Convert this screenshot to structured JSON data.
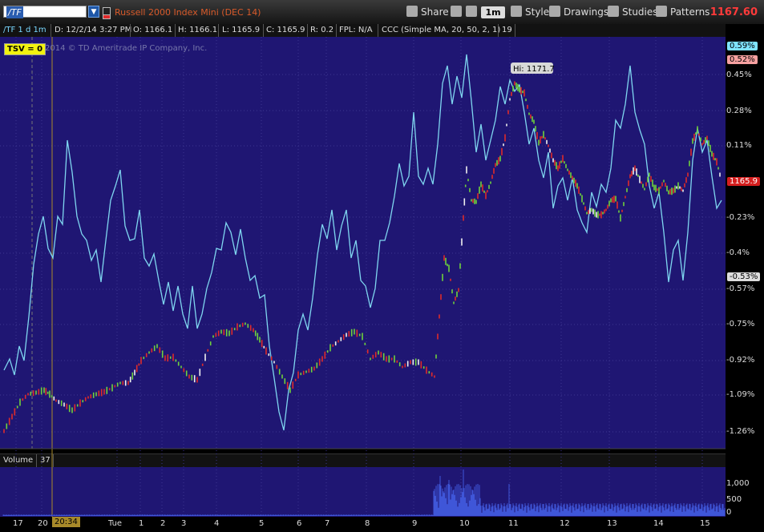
{
  "toolbar": {
    "symbol": "/TF",
    "title": "Russell 2000 Index Mini (DEC 14)",
    "share": "Share",
    "timeframe": "1m",
    "style": "Style",
    "drawings": "Drawings",
    "studies": "Studies",
    "patterns": "Patterns",
    "last_price": "1167.60"
  },
  "infobar": {
    "symbol_period": "/TF 1 d 1m",
    "date": "D: 12/2/14 3:27 PM",
    "open": "O: 1166.1",
    "high": "H: 1166.1",
    "low": "L: 1165.9",
    "close": "C: 1165.9",
    "range": "R: 0.2",
    "fpl": "FPL: N/A",
    "study": "CCC (Simple MA, 20, 50, 2, 1)",
    "study_value": "19"
  },
  "overlay": {
    "tsv": "TSV = 0",
    "copyright": "2014 © TD Ameritrade IP Company, Inc.",
    "hi_label": "Hi: 1171.7"
  },
  "price_axis": {
    "labels": [
      "0.45%",
      "0.28%",
      "0.11%",
      "-0.23%",
      "-0.4%",
      "-0.57%",
      "-0.75%",
      "-0.92%",
      "-1.09%",
      "-1.26%"
    ],
    "tag_top1": "0.59%",
    "tag_top2": "0.52%",
    "tag_price": "1165.9",
    "tag_neg": "-0.53%"
  },
  "volume": {
    "label": "Volume",
    "value": "37",
    "axis": [
      "1,000",
      "500",
      "0"
    ]
  },
  "time_axis": {
    "labels": [
      "17",
      "20",
      "Tue",
      "1",
      "2",
      "3",
      "4",
      "5",
      "6",
      "7",
      "8",
      "9",
      "10",
      "11",
      "12",
      "13",
      "14",
      "15"
    ],
    "cursor": "20:34"
  },
  "colors": {
    "panel_bg": "#1f1673",
    "oscillator": "#7fd6f0",
    "candle_up": "#6fd23c",
    "candle_down": "#e02a2a",
    "accent_price": "#ff3a3a"
  }
}
